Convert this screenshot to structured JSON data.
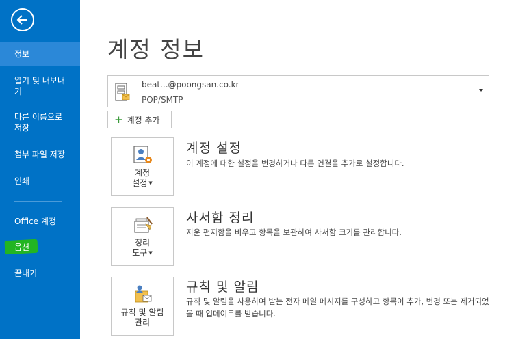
{
  "sidebar": {
    "nav": [
      {
        "id": "info",
        "label": "정보"
      },
      {
        "id": "open-export",
        "label": "열기 및 내보내기"
      },
      {
        "id": "save-as",
        "label": "다른 이름으로 저장"
      },
      {
        "id": "save-attachments",
        "label": "첨부 파일 저장"
      },
      {
        "id": "print",
        "label": "인쇄"
      },
      {
        "id": "office-account",
        "label": "Office 계정"
      },
      {
        "id": "options",
        "label": "옵션"
      },
      {
        "id": "exit",
        "label": "끝내기"
      }
    ]
  },
  "main": {
    "title": "계정 정보",
    "account": {
      "email": "beat...@poongsan.co.kr",
      "type": "POP/SMTP"
    },
    "add_account_label": "계정 추가",
    "sections": [
      {
        "button_line1": "계정",
        "button_line2": "설정",
        "title": "계정 설정",
        "description": "이 계정에 대한 설정을 변경하거나 다른 연결을 추가로 설정합니다."
      },
      {
        "button_line1": "정리",
        "button_line2": "도구",
        "title": "사서함 정리",
        "description": "지운 편지함을 비우고 항목을 보관하여 사서함 크기를 관리합니다."
      },
      {
        "button_line1": "규칙 및 알림",
        "button_line2": "관리",
        "title": "규칙 및 알림",
        "description": "규칙 및 알림을 사용하여 받는 전자 메일 메시지를 구성하고 항목이 추가, 변경 또는 제거되었을 때 업데이트를 받습니다."
      }
    ]
  }
}
